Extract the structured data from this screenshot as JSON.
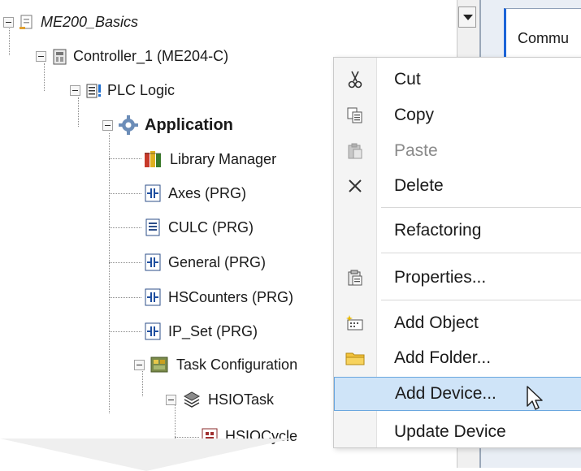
{
  "tree": {
    "items": [
      {
        "label": "ME200_Basics",
        "icon": "project-icon"
      },
      {
        "label": "Controller_1 (ME204-C)",
        "icon": "controller-icon"
      },
      {
        "label": "PLC Logic",
        "icon": "plc-logic-icon"
      },
      {
        "label": "Application",
        "icon": "application-gear-icon"
      },
      {
        "label": "Library Manager",
        "icon": "library-manager-icon"
      },
      {
        "label": "Axes (PRG)",
        "icon": "prg-icon"
      },
      {
        "label": "CULC (PRG)",
        "icon": "document-icon"
      },
      {
        "label": "General (PRG)",
        "icon": "prg-icon"
      },
      {
        "label": "HSCounters (PRG)",
        "icon": "prg-icon"
      },
      {
        "label": "IP_Set (PRG)",
        "icon": "prg-icon"
      },
      {
        "label": "Task Configuration",
        "icon": "task-configuration-icon"
      },
      {
        "label": "HSIOTask",
        "icon": "task-icon"
      },
      {
        "label": "HSIOCycle",
        "icon": "program-call-icon"
      }
    ]
  },
  "right_panel": {
    "tab_label": "Commu"
  },
  "context_menu": {
    "items": [
      {
        "label": "Cut",
        "icon": "scissors-icon",
        "enabled": true
      },
      {
        "label": "Copy",
        "icon": "copy-icon",
        "enabled": true
      },
      {
        "label": "Paste",
        "icon": "paste-icon",
        "enabled": false
      },
      {
        "label": "Delete",
        "icon": "delete-x-icon",
        "enabled": true
      },
      {
        "label": "Refactoring",
        "icon": "",
        "enabled": true
      },
      {
        "label": "Properties...",
        "icon": "properties-icon",
        "enabled": true
      },
      {
        "label": "Add Object",
        "icon": "add-object-icon",
        "enabled": true
      },
      {
        "label": "Add Folder...",
        "icon": "folder-icon",
        "enabled": true
      },
      {
        "label": "Add Device...",
        "icon": "",
        "enabled": true,
        "highlighted": true
      },
      {
        "label": "Update Device",
        "icon": "",
        "enabled": true
      }
    ]
  },
  "colors": {
    "highlight": "#cfe4f8",
    "highlight_border": "#6aa7df",
    "selected_tab_accent": "#1c64d8"
  }
}
